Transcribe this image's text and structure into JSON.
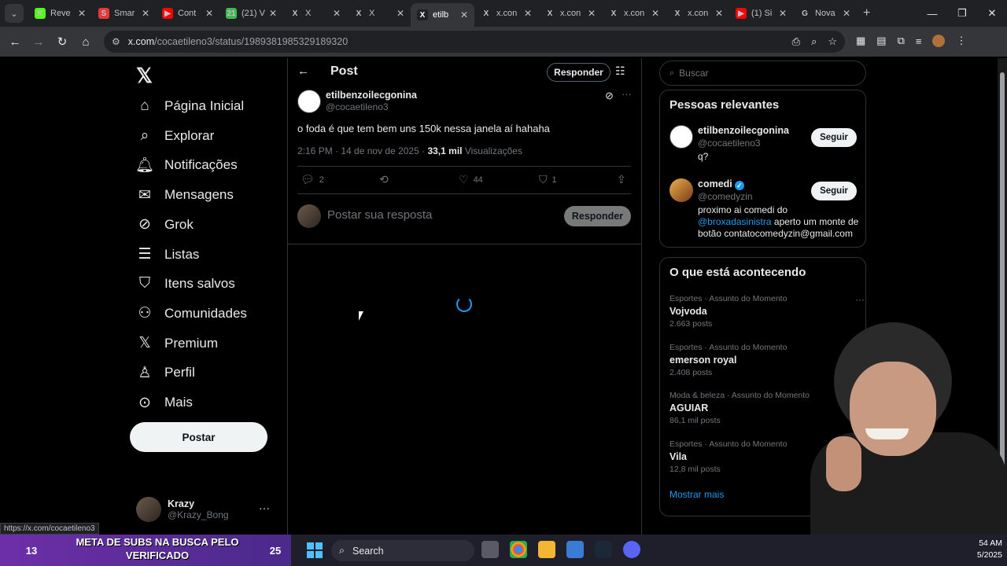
{
  "browser": {
    "tabs": [
      {
        "label": "Reve",
        "favicon": "K",
        "color": "#53fc18"
      },
      {
        "label": "Smar",
        "favicon": "S",
        "color": "#e53935"
      },
      {
        "label": "Cont",
        "favicon": "▶",
        "color": "#ff0000"
      },
      {
        "label": "(21) V",
        "favicon": "21",
        "color": "#3fb950"
      },
      {
        "label": "X",
        "favicon": "X",
        "color": "#202124"
      },
      {
        "label": "X",
        "favicon": "X",
        "color": "#202124"
      },
      {
        "label": "etilb",
        "favicon": "X",
        "color": "#202124"
      },
      {
        "label": "x.con",
        "favicon": "X",
        "color": "#202124"
      },
      {
        "label": "x.con",
        "favicon": "X",
        "color": "#202124"
      },
      {
        "label": "x.con",
        "favicon": "X",
        "color": "#202124"
      },
      {
        "label": "x.con",
        "favicon": "X",
        "color": "#202124"
      },
      {
        "label": "(1) Si",
        "favicon": "▶",
        "color": "#ff0000"
      },
      {
        "label": "Nova",
        "favicon": "G",
        "color": "#202124"
      }
    ],
    "active_tab_index": 6,
    "url_host": "x.com",
    "url_path": "/cocaetileno3/status/1989381985329189320",
    "status_url": "https://x.com/cocaetileno3"
  },
  "sidebar": {
    "items": [
      {
        "label": "Página Inicial",
        "icon": "home-icon"
      },
      {
        "label": "Explorar",
        "icon": "search-icon"
      },
      {
        "label": "Notificações",
        "icon": "bell-icon"
      },
      {
        "label": "Mensagens",
        "icon": "mail-icon"
      },
      {
        "label": "Grok",
        "icon": "grok-icon"
      },
      {
        "label": "Listas",
        "icon": "list-icon"
      },
      {
        "label": "Itens salvos",
        "icon": "bookmark-icon"
      },
      {
        "label": "Comunidades",
        "icon": "people-icon"
      },
      {
        "label": "Premium",
        "icon": "x-icon"
      },
      {
        "label": "Perfil",
        "icon": "person-icon"
      },
      {
        "label": "Mais",
        "icon": "more-circle-icon"
      }
    ],
    "post_button": "Postar",
    "account": {
      "name": "Krazy",
      "handle": "@Krazy_Bong"
    }
  },
  "post": {
    "header_title": "Post",
    "reply_pill": "Responder",
    "author_name": "etilbenzoilecgonina",
    "author_handle": "@cocaetileno3",
    "text": "o foda é que tem bem uns 150k nessa janela aí hahaha",
    "time": "2:16 PM · 14 de nov de 2025 · ",
    "views_count": "33,1 mil",
    "views_label": " Visualizações",
    "replies": "2",
    "reposts": "",
    "likes": "44",
    "bookmarks": "1",
    "reply_placeholder": "Postar sua resposta",
    "reply_button": "Responder"
  },
  "right": {
    "search_placeholder": "Buscar",
    "relevant_title": "Pessoas relevantes",
    "people": [
      {
        "name": "etilbenzoilecgonina",
        "handle": "@cocaetileno3",
        "bio": "q?",
        "follow": "Seguir",
        "verified": false
      },
      {
        "name": "comedi",
        "handle": "@comedyzin",
        "bio_pre": "proximo ai comedi do ",
        "bio_mention": "@broxadasinistra",
        "bio_post": " aperto um monte de botão contatocomedyzin@gmail.com",
        "follow": "Seguir",
        "verified": true
      }
    ],
    "trends_title": "O que está acontecendo",
    "trends": [
      {
        "category": "Esportes · Assunto do Momento",
        "name": "Vojvoda",
        "count": "2.663 posts"
      },
      {
        "category": "Esportes · Assunto do Momento",
        "name": "emerson royal",
        "count": "2.408 posts"
      },
      {
        "category": "Moda & beleza · Assunto do Momento",
        "name": "AGUIAR",
        "count": "86,1 mil posts"
      },
      {
        "category": "Esportes · Assunto do Momento",
        "name": "Vila",
        "count": "12,8 mil posts"
      }
    ],
    "show_more": "Mostrar mais"
  },
  "overlay": {
    "goal_left": "13",
    "goal_text": "META DE SUBS NA BUSCA PELO VERIFICADO",
    "goal_right": "25"
  },
  "taskbar": {
    "search_label": "Search",
    "clock_time": "54 AM",
    "clock_date": "5/2025"
  }
}
